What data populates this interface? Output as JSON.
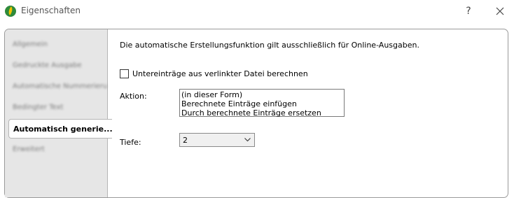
{
  "window": {
    "title": "Eigenschaften",
    "help_label": "?"
  },
  "sidebar": {
    "items": [
      {
        "label": "Allgemein"
      },
      {
        "label": "Gedruckte Ausgabe"
      },
      {
        "label": "Automatische Nummerierung"
      },
      {
        "label": "Bedingter Text"
      },
      {
        "label": "Automatisch generie..."
      },
      {
        "label": "Erweitert"
      }
    ],
    "active_index": 4
  },
  "content": {
    "info": "Die automatische Erstellungsfunktion gilt ausschließlich für Online-Ausgaben.",
    "checkbox": {
      "label": "Untereinträge aus verlinkter Datei berechnen",
      "checked": false
    },
    "aktion": {
      "label": "Aktion:",
      "options": [
        "(in dieser Form)",
        "Berechnete Einträge einfügen",
        "Durch berechnete Einträge ersetzen"
      ]
    },
    "tiefe": {
      "label": "Tiefe:",
      "value": "2"
    }
  },
  "colors": {
    "app_icon": "#2f8a3a",
    "sidebar_bg": "#e6e6e6"
  }
}
